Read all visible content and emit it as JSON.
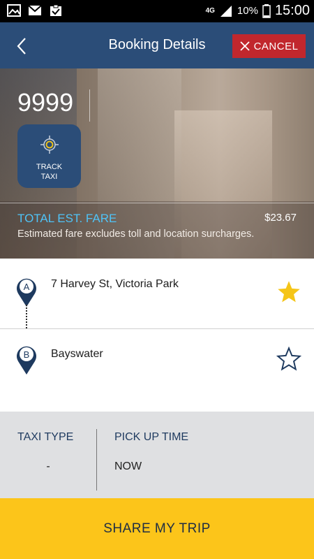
{
  "status_bar": {
    "network": "4G",
    "battery": "10%",
    "time": "15:00",
    "left_icons": [
      "gallery-icon",
      "gmail-icon",
      "clipboard-check-icon"
    ]
  },
  "header": {
    "title": "Booking Details",
    "cancel_label": "CANCEL"
  },
  "booking": {
    "taxi_number": "9999",
    "track_label_line1": "TRACK",
    "track_label_line2": "TAXI",
    "fare_label": "TOTAL EST. FARE",
    "fare_value": "$23.67",
    "fare_note": "Estimated fare excludes toll and location surcharges."
  },
  "pickup": {
    "marker": "A",
    "address": "7  Harvey St, Victoria Park",
    "favorite": true
  },
  "dropoff": {
    "marker": "B",
    "address": "Bayswater",
    "favorite": false
  },
  "details": {
    "taxi_type_label": "TAXI TYPE",
    "taxi_type_value": "-",
    "pickup_time_label": "PICK UP TIME",
    "pickup_time_value": "NOW"
  },
  "share_label": "SHARE MY TRIP",
  "colors": {
    "header": "#2b4d78",
    "cancel": "#c1272d",
    "fare_label": "#4fc3f7",
    "star_filled": "#f5c518",
    "share_button": "#fcc51a"
  }
}
